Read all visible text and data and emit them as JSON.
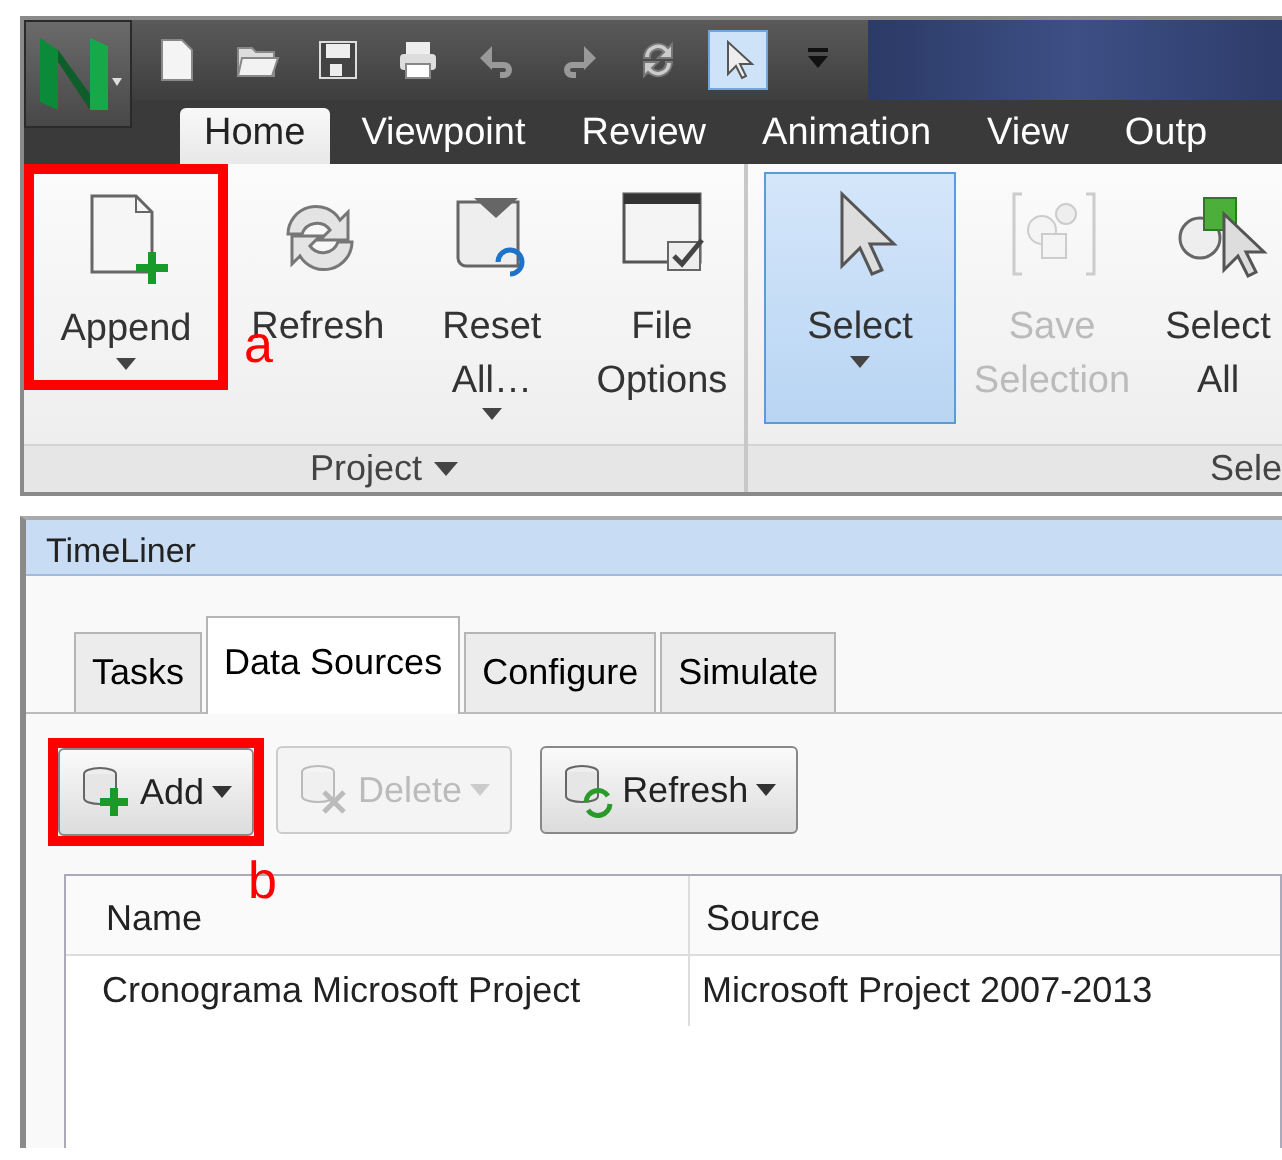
{
  "ribbon_tabs": [
    {
      "label": "Home",
      "selected": true
    },
    {
      "label": "Viewpoint",
      "selected": false
    },
    {
      "label": "Review",
      "selected": false
    },
    {
      "label": "Animation",
      "selected": false
    },
    {
      "label": "View",
      "selected": false
    },
    {
      "label": "Outp",
      "selected": false
    }
  ],
  "ribbon_groups": [
    {
      "label": "Project",
      "dropdown": true,
      "buttons": [
        {
          "label": "Append",
          "dropdown": true,
          "disabled": false,
          "selected": false,
          "annotation": "a"
        },
        {
          "label": "Refresh",
          "dropdown": false,
          "disabled": false,
          "selected": false
        },
        {
          "label": "Reset All…",
          "dropdown": true,
          "disabled": false,
          "selected": false
        },
        {
          "label": "File Options",
          "dropdown": false,
          "disabled": false,
          "selected": false
        }
      ]
    },
    {
      "label": "Sele",
      "dropdown": false,
      "buttons": [
        {
          "label": "Select",
          "dropdown": true,
          "disabled": false,
          "selected": true
        },
        {
          "label": "Save Selection",
          "dropdown": false,
          "disabled": true,
          "selected": false
        },
        {
          "label": "Select All",
          "dropdown": false,
          "disabled": false,
          "selected": false
        }
      ]
    }
  ],
  "panel": {
    "title": "TimeLiner",
    "tabs": [
      {
        "label": "Tasks",
        "selected": false
      },
      {
        "label": "Data Sources",
        "selected": true
      },
      {
        "label": "Configure",
        "selected": false
      },
      {
        "label": "Simulate",
        "selected": false
      }
    ],
    "toolbar": [
      {
        "label": "Add",
        "disabled": false,
        "annotation": "b"
      },
      {
        "label": "Delete",
        "disabled": true
      },
      {
        "label": "Refresh",
        "disabled": false
      }
    ],
    "table": {
      "columns": [
        "Name",
        "Source"
      ],
      "rows": [
        [
          "Cronograma Microsoft Project",
          "Microsoft Project 2007-2013"
        ]
      ]
    }
  }
}
